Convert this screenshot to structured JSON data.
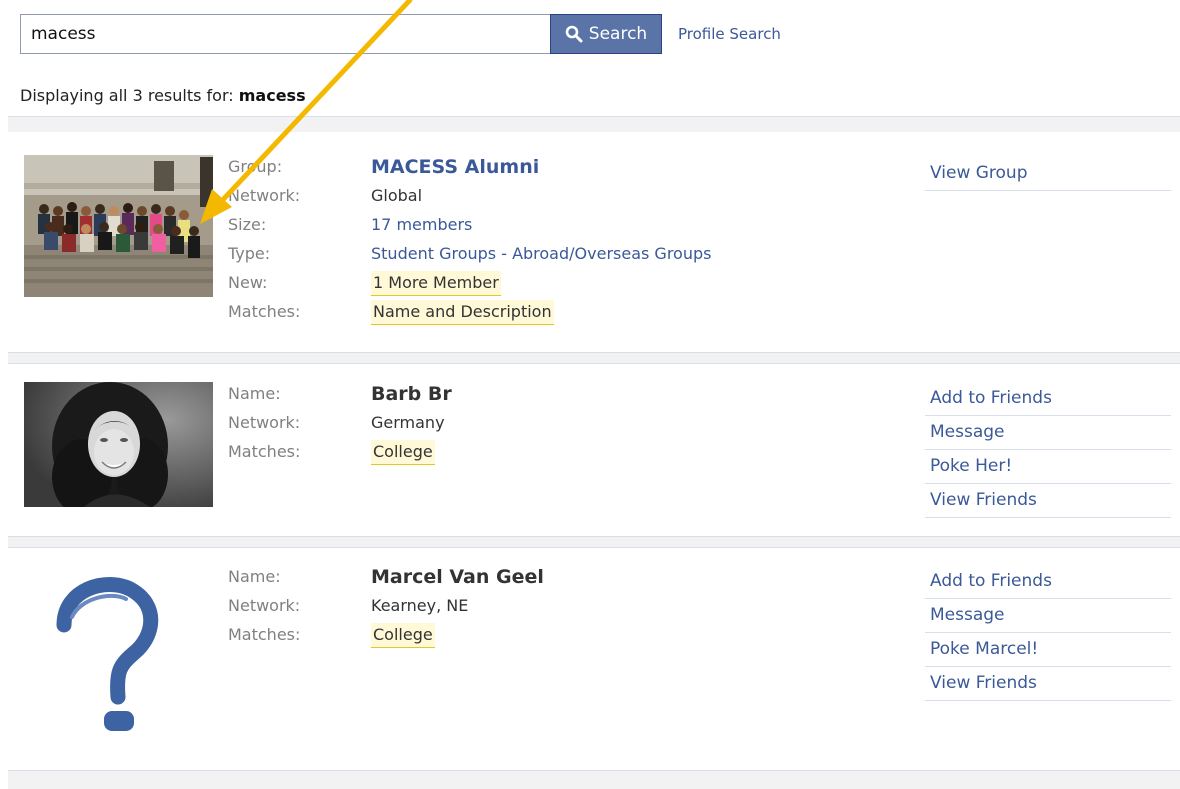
{
  "search": {
    "query": "macess",
    "button_label": "Search",
    "profile_search_label": "Profile Search"
  },
  "summary": {
    "prefix": "Displaying all 3 results for:",
    "term": "macess"
  },
  "results": [
    {
      "kind": "group",
      "labels": [
        "Group:",
        "Network:",
        "Size:",
        "Type:",
        "New:",
        "Matches:"
      ],
      "values": [
        "MACESS Alumni",
        "Global",
        "17 members",
        "Student Groups - Abroad/Overseas Groups",
        "1 More Member",
        "Name and Description"
      ],
      "actions": [
        "View Group"
      ]
    },
    {
      "kind": "person",
      "labels": [
        "Name:",
        "Network:",
        "Matches:"
      ],
      "values": [
        "Barb Br",
        "Germany",
        "College"
      ],
      "actions": [
        "Add to Friends",
        "Message",
        "Poke Her!",
        "View Friends"
      ]
    },
    {
      "kind": "person",
      "labels": [
        "Name:",
        "Network:",
        "Matches:"
      ],
      "values": [
        "Marcel Van Geel",
        "Kearney, NE",
        "College"
      ],
      "actions": [
        "Add to Friends",
        "Message",
        "Poke Marcel!",
        "View Friends"
      ]
    }
  ],
  "icons": {
    "search": "magnifier-icon",
    "placeholder_avatar": "question-mark-icon"
  },
  "colors": {
    "link": "#3b5998",
    "button": "#5b74a8",
    "highlight": "#fff9d7",
    "arrow": "#f5b800"
  }
}
